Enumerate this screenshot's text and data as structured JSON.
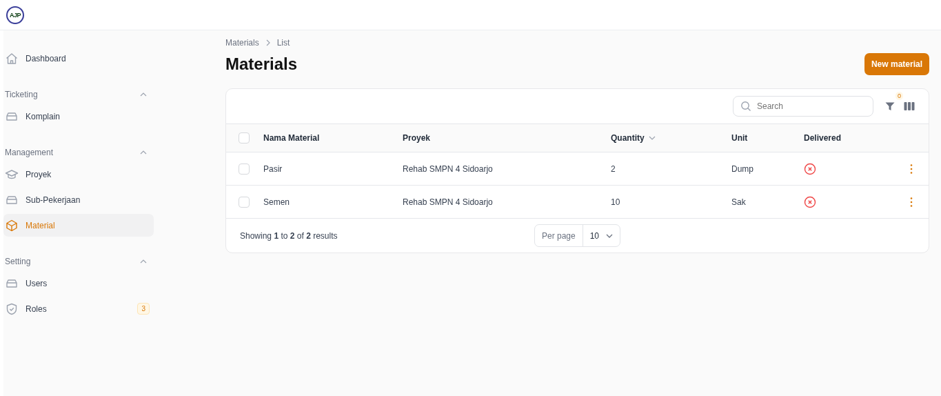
{
  "logo": {
    "text": "AJP"
  },
  "sidebar": {
    "groups": [
      {
        "items": [
          {
            "label": "Dashboard",
            "kind": "home",
            "selected": false
          }
        ]
      },
      {
        "label": "Ticketing",
        "expanded": true,
        "items": [
          {
            "label": "Komplain",
            "kind": "tray",
            "selected": false
          }
        ]
      },
      {
        "label": "Management",
        "expanded": true,
        "items": [
          {
            "label": "Proyek",
            "kind": "cap",
            "selected": false
          },
          {
            "label": "Sub-Pekerjaan",
            "kind": "tray",
            "selected": false
          },
          {
            "label": "Material",
            "kind": "cube",
            "selected": true
          }
        ]
      },
      {
        "label": "Setting",
        "expanded": true,
        "items": [
          {
            "label": "Users",
            "kind": "tray",
            "selected": false
          },
          {
            "label": "Roles",
            "kind": "shield",
            "selected": false,
            "badge": "3"
          }
        ]
      }
    ]
  },
  "breadcrumb": [
    "Materials",
    "List"
  ],
  "title": "Materials",
  "new_button": "New material",
  "table": {
    "search": {
      "placeholder": "Search"
    },
    "filter_count": "0",
    "select_all_checked": false,
    "columns": [
      {
        "label": "Nama Material",
        "sortable": false
      },
      {
        "label": "Proyek",
        "sortable": false
      },
      {
        "label": "Quantity",
        "sortable": true
      },
      {
        "label": "Unit",
        "sortable": false
      },
      {
        "label": "Delivered",
        "sortable": false
      }
    ],
    "rows": [
      {
        "checked": false,
        "cells": [
          "Pasir",
          "Rehab SMPN 4 Sidoarjo",
          "2",
          "Dump"
        ],
        "delivered": false
      },
      {
        "checked": false,
        "cells": [
          "Semen",
          "Rehab SMPN 4 Sidoarjo",
          "10",
          "Sak"
        ],
        "delivered": false
      }
    ],
    "summary": "Showing **1** to **2** of **2** results",
    "per_page": {
      "label": "Per page",
      "value": "10"
    }
  }
}
